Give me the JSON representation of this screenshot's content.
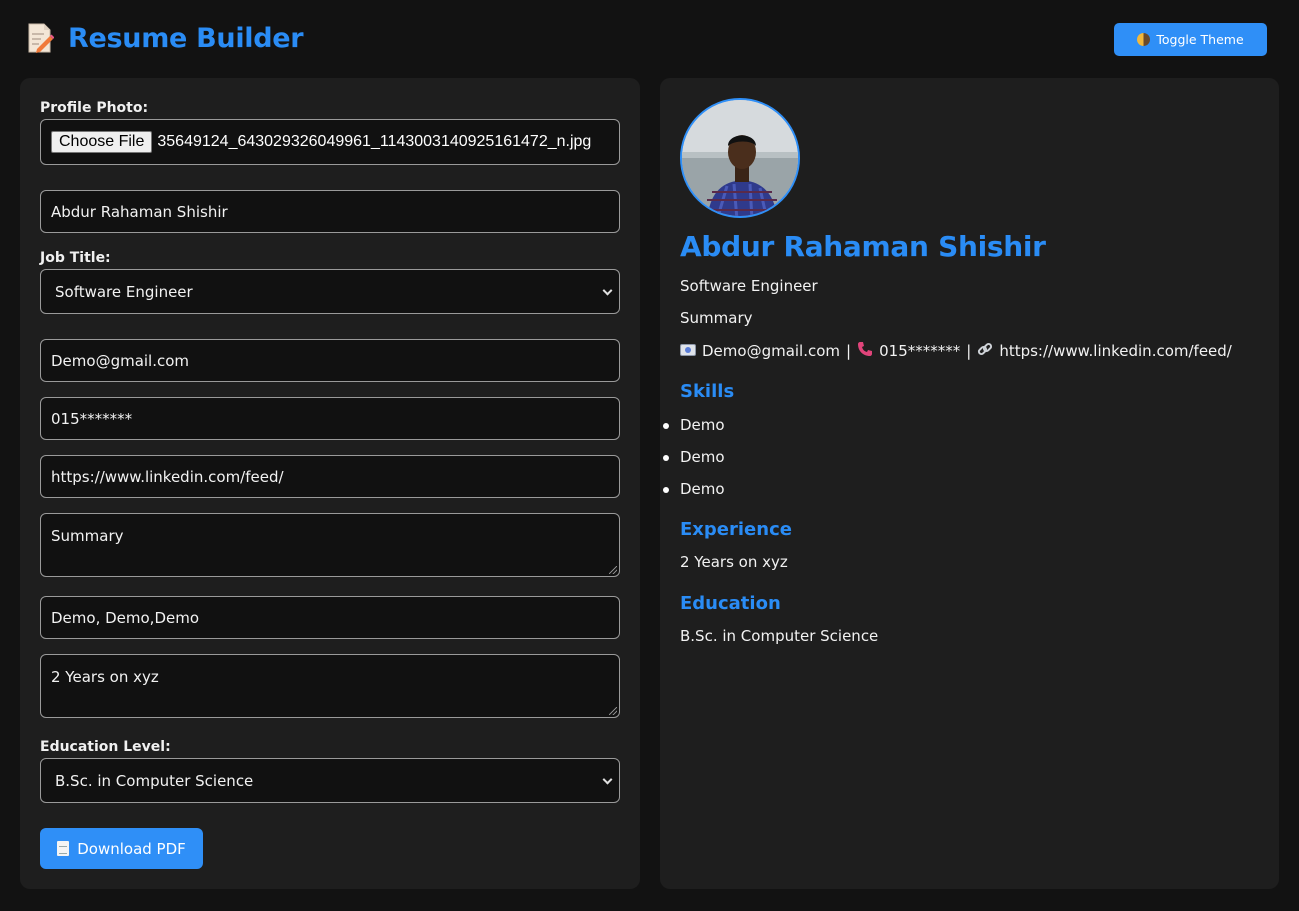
{
  "header": {
    "icon": "memo-icon",
    "title": "Resume Builder",
    "toggle_label": "Toggle Theme",
    "toggle_icon": "half-moon-icon",
    "accent": "#2a8cf5"
  },
  "form": {
    "profile_photo_label": "Profile Photo:",
    "choose_file_label": "Choose File",
    "file_name": "35649124_643029326049961_1143003140925161472_n.jpg",
    "full_name": "Abdur Rahaman Shishir",
    "job_title_label": "Job Title:",
    "job_title": "Software Engineer",
    "email": "Demo@gmail.com",
    "phone": "015*******",
    "linkedin": "https://www.linkedin.com/feed/",
    "summary": "Summary",
    "skills": "Demo, Demo,Demo",
    "experience": "2 Years on xyz",
    "education_label": "Education Level:",
    "education": "B.Sc. in Computer Science",
    "download_label": "Download PDF",
    "download_icon": "page-icon"
  },
  "preview": {
    "name": "Abdur Rahaman Shishir",
    "job_title": "Software Engineer",
    "summary": "Summary",
    "email": "Demo@gmail.com",
    "separator": "|",
    "phone": "015*******",
    "linkedin": "https://www.linkedin.com/feed/",
    "skills_heading": "Skills",
    "skills": [
      "Demo",
      "Demo",
      "Demo"
    ],
    "experience_heading": "Experience",
    "experience": "2 Years on xyz",
    "education_heading": "Education",
    "education": "B.Sc. in Computer Science"
  }
}
